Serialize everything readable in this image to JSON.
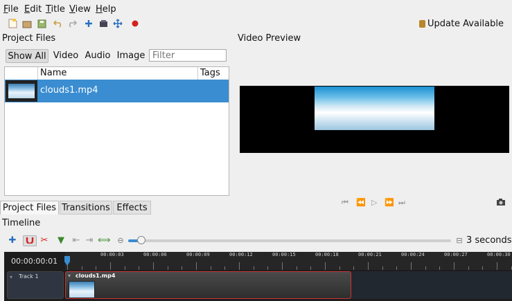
{
  "menubar": {
    "items": [
      {
        "label": "File"
      },
      {
        "label": "Edit"
      },
      {
        "label": "Title"
      },
      {
        "label": "View"
      },
      {
        "label": "Help"
      }
    ]
  },
  "toolbar": {
    "update_label": "Update Available",
    "icons": [
      "new-project-icon",
      "open-project-icon",
      "save-project-icon",
      "undo-icon",
      "redo-icon",
      "import-files-icon",
      "profile-icon",
      "fullscreen-icon",
      "record-icon"
    ]
  },
  "project_files": {
    "title": "Project Files",
    "filters": [
      "Show All",
      "Video",
      "Audio",
      "Image"
    ],
    "filter_placeholder": "Filter",
    "columns": [
      "Name",
      "Tags"
    ],
    "files": [
      {
        "name": "clouds1.mp4",
        "tags": ""
      }
    ]
  },
  "bottom_tabs": [
    "Project Files",
    "Transitions",
    "Effects"
  ],
  "preview": {
    "title": "Video Preview"
  },
  "timeline": {
    "title": "Timeline",
    "zoom_label": "3 seconds",
    "zoom_fraction": 0.04,
    "timecode": "00:00:00:01",
    "ruler_labels": [
      "00:00:03",
      "00:00:06",
      "00:00:09",
      "00:00:12",
      "00:00:15",
      "00:00:18",
      "00:00:21",
      "00:00:24",
      "00:00:27",
      "00:00:30"
    ],
    "track_name": "Track 1",
    "clip_name": "clouds1.mp4"
  },
  "colors": {
    "selection": "#3a8dd0",
    "record": "#d42020",
    "clip_border": "#cc3333"
  }
}
